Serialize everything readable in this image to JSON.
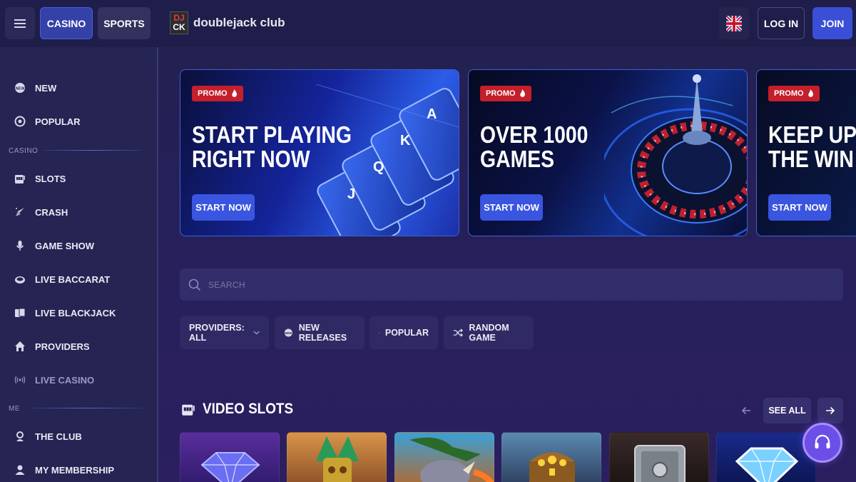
{
  "header": {
    "tabs": [
      {
        "label": "CASINO",
        "active": true
      },
      {
        "label": "SPORTS",
        "active": false
      }
    ],
    "brand": "doublejack club",
    "logo_top": "DJ",
    "logo_bottom": "CK",
    "language": "English (UK flag)",
    "login_label": "LOG IN",
    "join_label": "JOIN"
  },
  "sidebar": {
    "top_items": [
      {
        "label": "NEW",
        "icon": "new-badge-icon"
      },
      {
        "label": "POPULAR",
        "icon": "popular-icon"
      }
    ],
    "sections": [
      {
        "title": "CASINO",
        "items": [
          {
            "label": "SLOTS",
            "icon": "slot-machine-icon"
          },
          {
            "label": "CRASH",
            "icon": "rocket-icon"
          },
          {
            "label": "GAME SHOW",
            "icon": "microphone-icon"
          },
          {
            "label": "LIVE BACCARAT",
            "icon": "baccarat-icon"
          },
          {
            "label": "LIVE BLACKJACK",
            "icon": "cards-icon"
          },
          {
            "label": "PROVIDERS",
            "icon": "house-icon"
          },
          {
            "label": "LIVE CASINO",
            "icon": "live-signal-icon",
            "dim": true
          }
        ]
      },
      {
        "title": "ME",
        "items": [
          {
            "label": "THE CLUB",
            "icon": "club-badge-icon"
          },
          {
            "label": "MY MEMBERSHIP",
            "icon": "user-icon"
          }
        ]
      }
    ]
  },
  "banners": [
    {
      "tag": "PROMO",
      "title_line1": "START PLAYING",
      "title_line2": "RIGHT NOW",
      "button": "START NOW"
    },
    {
      "tag": "PROMO",
      "title_line1": "OVER 1000",
      "title_line2": "GAMES",
      "button": "START NOW"
    },
    {
      "tag": "PROMO",
      "title_line1": "KEEP UP",
      "title_line2": "THE WIN",
      "button": "START NOW"
    }
  ],
  "search": {
    "placeholder": "SEARCH",
    "value": ""
  },
  "filters": [
    {
      "label": "PROVIDERS: ALL",
      "icon": "chevron-down-icon"
    },
    {
      "label": "NEW RELEASES",
      "icon": "new-badge-icon"
    },
    {
      "label": "POPULAR",
      "icon": "flame-icon"
    },
    {
      "label": "RANDOM GAME",
      "icon": "shuffle-icon"
    }
  ],
  "section": {
    "title": "VIDEO SLOTS",
    "icon": "slot-machine-icon",
    "see_all": "SEE ALL"
  },
  "games": [
    "diamond",
    "aztec-mask",
    "rhino",
    "treasure-chest",
    "safe",
    "gem"
  ],
  "colors": {
    "accent": "#3a4fd6",
    "promo": "#c41f2a",
    "support": "#6b4fe6",
    "background": "#26205a"
  }
}
